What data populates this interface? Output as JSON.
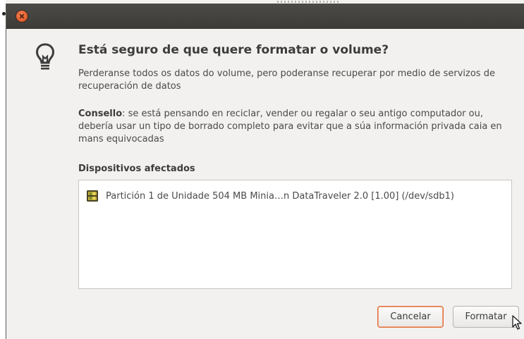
{
  "dialog": {
    "title": "Está seguro de que quere formatar o volume?",
    "message": "Perderanse todos os datos do volume, pero poderanse recuperar por medio de servizos de recuperación de datos",
    "tip_label": "Consello",
    "tip_text": ": se está pensando en reciclar, vender ou regalar o seu antigo computador ou, debería usar un tipo de borrado completo para evitar que a súa información privada caia en mans equivocadas",
    "affected_label": "Dispositivos afectados",
    "devices": [
      {
        "label": "Partición 1 de Unidade 504 MB Minia…n DataTraveler 2.0 [1.00] (/dev/sdb1)",
        "icon": "usb-drive-icon"
      }
    ],
    "buttons": {
      "cancel": "Cancelar",
      "format": "Formatar"
    }
  },
  "icons": {
    "window_close": "close-icon",
    "hint": "lightbulb-icon",
    "pointer": "mouse-pointer-icon"
  },
  "colors": {
    "titlebar": "#3c3b37",
    "close": "#e95420",
    "dialog_bg": "#f2f1f0",
    "default_button_border": "#e0703e"
  }
}
